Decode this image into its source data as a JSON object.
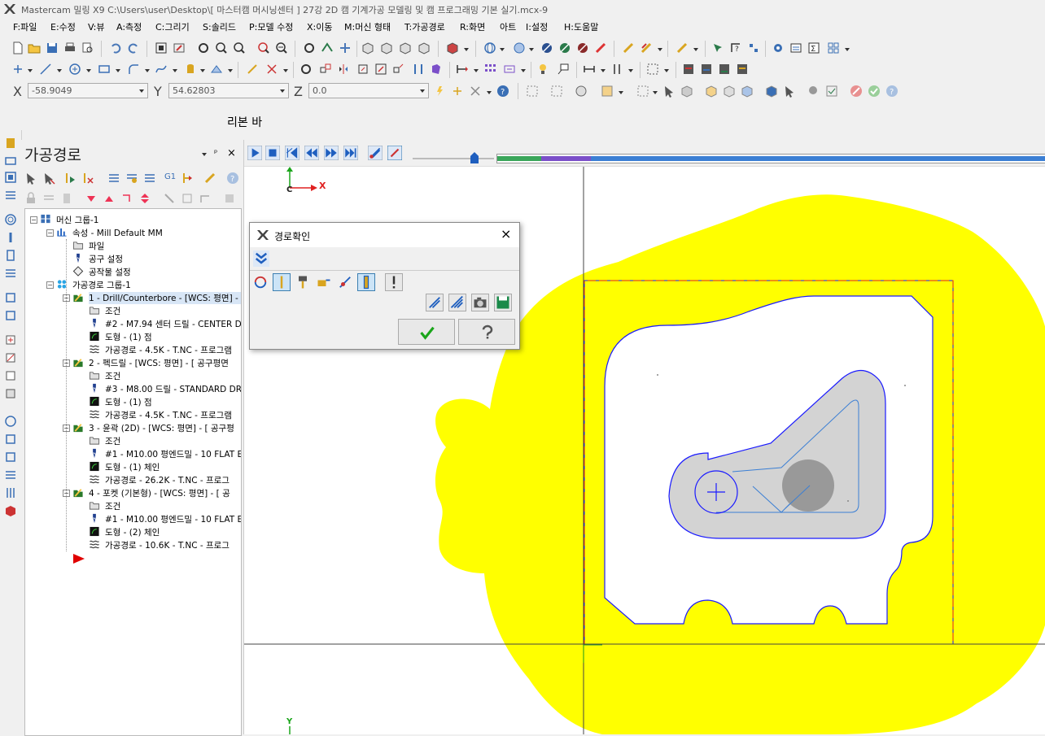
{
  "window": {
    "title": "Mastercam 밀링 X9  C:\\Users\\user\\Desktop\\[ 마스터캠 머시닝센터 ] 27강 2D 캠 기계가공 모델링 및 캠 프로그래밍 기본 실기.mcx-9"
  },
  "menu": [
    "F:파일",
    "E:수정",
    "V:뷰",
    "A:측정",
    "C:그리기",
    "S:솔리드",
    "P:모델 수정",
    "X:이동",
    "M:머신 형태",
    "T:가공경로",
    "R:화면",
    "아트",
    "I:설정",
    "H:도움말"
  ],
  "coords": {
    "x_label": "X",
    "x_value": "-58.9049",
    "y_label": "Y",
    "y_value": "54.62803",
    "z_label": "Z",
    "z_value": "0.0"
  },
  "ribbon_label": "리본 바",
  "panel": {
    "title": "가공경로",
    "pin": "ᵖ",
    "close": "×"
  },
  "tree": [
    {
      "text": "머신 그룹-1",
      "level": 0,
      "icon": "machine-group-icon"
    },
    {
      "text": "속성 - Mill Default MM",
      "level": 1,
      "icon": "properties-icon"
    },
    {
      "text": "파일",
      "level": 2,
      "icon": "folder-icon"
    },
    {
      "text": "공구 설정",
      "level": 2,
      "icon": "tool-icon"
    },
    {
      "text": "공작물 설정",
      "level": 2,
      "icon": "stock-icon"
    },
    {
      "text": "가공경로 그룹-1",
      "level": 1,
      "icon": "toolpath-group-icon"
    },
    {
      "text": "1 - Drill/Counterbore - [WCS: 평면] - [",
      "level": 2,
      "icon": "operation-icon",
      "selected": true
    },
    {
      "text": "조건",
      "level": 3,
      "icon": "folder-icon"
    },
    {
      "text": "#2 - M7.94 센터 드릴 - CENTER D",
      "level": 3,
      "icon": "tool-icon"
    },
    {
      "text": "도형 - (1) 점",
      "level": 3,
      "icon": "geometry-icon"
    },
    {
      "text": "가공경로 - 4.5K - T.NC - 프로그램",
      "level": 3,
      "icon": "toolpath-icon"
    },
    {
      "text": "2 - 펙드릴 - [WCS: 평면] - [  공구평면",
      "level": 2,
      "icon": "operation-icon"
    },
    {
      "text": "조건",
      "level": 3,
      "icon": "folder-icon"
    },
    {
      "text": "#3 - M8.00 드릴 - STANDARD DRI",
      "level": 3,
      "icon": "tool-icon"
    },
    {
      "text": "도형 - (1) 점",
      "level": 3,
      "icon": "geometry-icon"
    },
    {
      "text": "가공경로 - 4.5K - T.NC - 프로그램",
      "level": 3,
      "icon": "toolpath-icon"
    },
    {
      "text": "3 - 윤곽 (2D) - [WCS: 평면] - [  공구평",
      "level": 2,
      "icon": "operation-icon"
    },
    {
      "text": "조건",
      "level": 3,
      "icon": "folder-icon"
    },
    {
      "text": "#1 - M10.00 평엔드밀 - 10 FLAT E",
      "level": 3,
      "icon": "tool-icon"
    },
    {
      "text": "도형 - (1) 체인",
      "level": 3,
      "icon": "geometry-icon"
    },
    {
      "text": "가공경로 - 26.2K - T.NC - 프로그",
      "level": 3,
      "icon": "toolpath-icon"
    },
    {
      "text": "4 - 포켓 (기본형) - [WCS: 평면] - [  공",
      "level": 2,
      "icon": "operation-icon"
    },
    {
      "text": "조건",
      "level": 3,
      "icon": "folder-icon"
    },
    {
      "text": "#1 - M10.00 평엔드밀 - 10 FLAT E",
      "level": 3,
      "icon": "tool-icon"
    },
    {
      "text": "도형 - (2) 체인",
      "level": 3,
      "icon": "geometry-icon"
    },
    {
      "text": "가공경로 - 10.6K - T.NC - 프로그",
      "level": 3,
      "icon": "toolpath-icon"
    }
  ],
  "dialog": {
    "title": "경로확인",
    "close": "×"
  },
  "axis": {
    "x_label": "X",
    "c_label": "C",
    "y_label": "Y"
  },
  "colors": {
    "accent_blue": "#1f5fbf",
    "toolpath_yellow": "#ffff00",
    "stock_red": "#e02020",
    "contour_blue": "#1a1aff",
    "pocket_gray": "#d3d3d3",
    "progress_green": "#3aa65a",
    "progress_purple": "#7b4fc9",
    "progress_blue": "#3b7fd4"
  },
  "playback": {
    "position_fraction": 0.78
  }
}
